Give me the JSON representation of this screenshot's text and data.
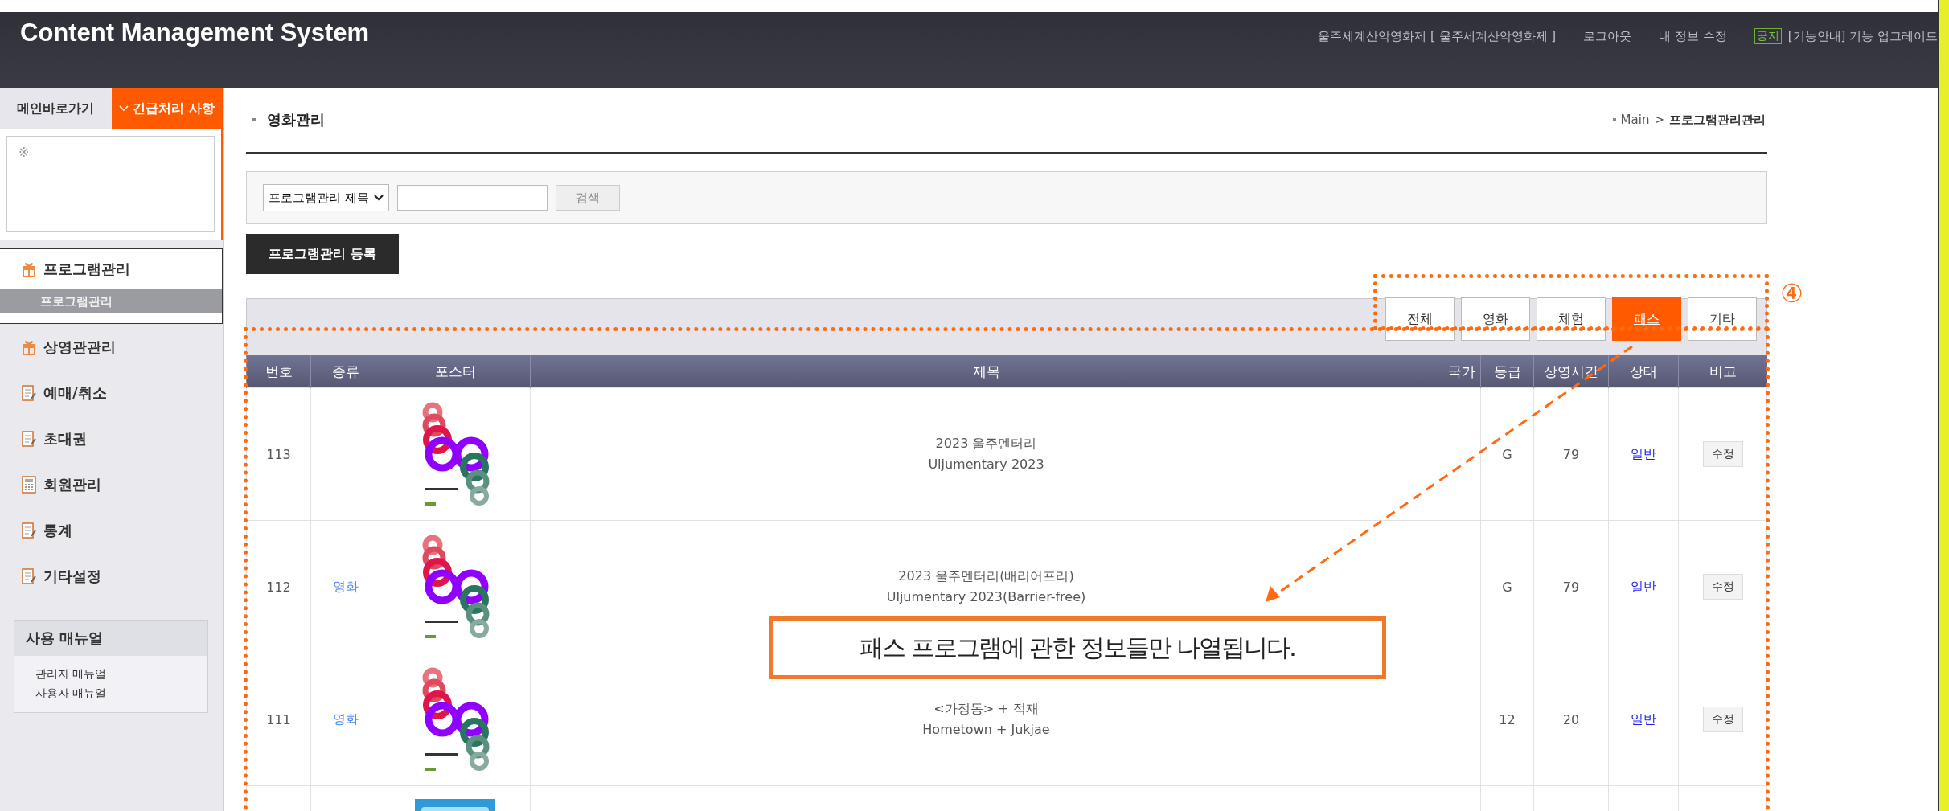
{
  "header": {
    "title": "Content Management System",
    "links": [
      "울주세계산악영화제 [ 울주세계산악영화제 ]",
      "로그아웃",
      "내 정보 수정"
    ],
    "notice_badge": "공지",
    "notice_text": "[기능안내] 기능 업그레이드"
  },
  "sidebar": {
    "top_buttons": [
      {
        "label": "메인바로가기",
        "kind": "plain",
        "selected": false
      },
      {
        "label": "긴급처리 사항",
        "kind": "dropdown",
        "selected": true
      }
    ],
    "note": "※",
    "menu": [
      {
        "label": "프로그램관리",
        "kind": "gift",
        "expanded": true,
        "children": [
          {
            "label": "프로그램관리",
            "selected": true
          }
        ]
      },
      {
        "label": "상영관관리",
        "kind": "gift",
        "expanded": false
      },
      {
        "label": "예매/취소",
        "kind": "note",
        "expanded": false
      },
      {
        "label": "초대권",
        "kind": "note",
        "expanded": false
      },
      {
        "label": "회원관리",
        "kind": "calc",
        "expanded": false
      },
      {
        "label": "통계",
        "kind": "note",
        "expanded": false
      },
      {
        "label": "기타설정",
        "kind": "note",
        "expanded": false
      }
    ],
    "manual": {
      "title": "사용 매뉴얼",
      "links": [
        "관리자 매뉴얼",
        "사용자 매뉴얼"
      ]
    }
  },
  "content": {
    "page_title": "영화관리",
    "breadcrumb": {
      "root": "Main",
      "separator": ">",
      "current": "프로그램관리관리"
    },
    "search": {
      "select": "프로그램관리 제목",
      "button": "검색"
    },
    "register_button": "프로그램관리 등록",
    "filter_tabs": [
      {
        "label": "전체",
        "selected": false
      },
      {
        "label": "영화",
        "selected": false
      },
      {
        "label": "체험",
        "selected": false
      },
      {
        "label": "패스",
        "selected": true
      },
      {
        "label": "기타",
        "selected": false
      }
    ],
    "table": {
      "columns": [
        "번호",
        "종류",
        "포스터",
        "제목",
        "국가",
        "등급",
        "상영시간",
        "상태",
        "비고"
      ],
      "rows": [
        {
          "number": "113",
          "kind": "rings",
          "title_ko": "2023 울주멘터리",
          "title_en": "Uljumentary 2023",
          "grade": "G",
          "runtime": "79",
          "status": "일반",
          "action": "수정"
        },
        {
          "number": "112",
          "type": "영화",
          "kind": "rings",
          "title_ko": "2023 울주멘터리(배리어프리)",
          "title_en": "Uljumentary 2023(Barrier-free)",
          "grade": "G",
          "runtime": "79",
          "status": "일반",
          "action": "수정"
        },
        {
          "number": "111",
          "type": "영화",
          "kind": "rings",
          "title_ko": "<가정동> + 적재",
          "title_en": "Hometown + Jukjae",
          "grade": "12",
          "runtime": "20",
          "status": "일반",
          "action": "수정"
        },
        {
          "kind": "blue"
        }
      ]
    }
  },
  "annotation": {
    "marker": "④",
    "callout": "패스 프로그램에 관한 정보들만 나열됩니다."
  }
}
